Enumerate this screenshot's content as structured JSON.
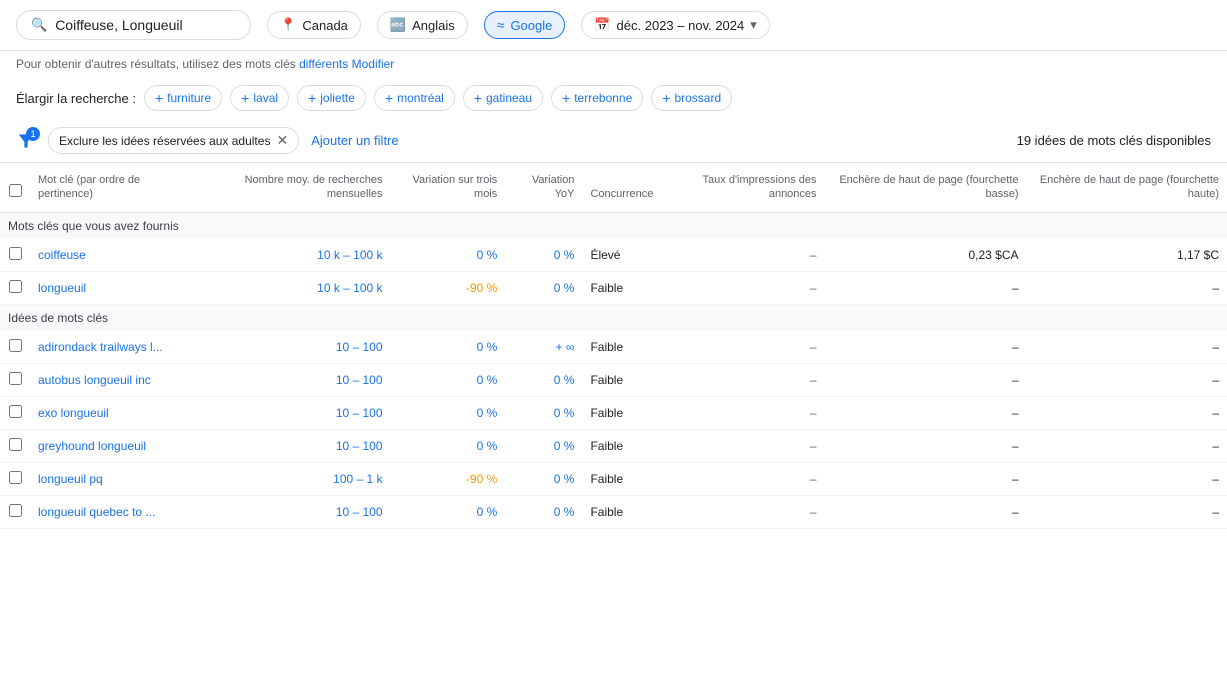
{
  "topbar": {
    "search_value": "Coiffeuse, Longueuil",
    "search_icon": "🔍",
    "location": "Canada",
    "location_icon": "📍",
    "language": "Anglais",
    "language_icon": "🔤",
    "platform": "Google",
    "platform_icon": "≈",
    "date_range": "déc. 2023 – nov. 2024",
    "date_icon": "📅"
  },
  "subtitle": {
    "text": "Pour obtenir d'autres résultats, utilisez des mots clés ",
    "link_text": "différents",
    "modify_text": "Modifier"
  },
  "expand": {
    "label": "Élargir la recherche :",
    "chips": [
      "furniture",
      "laval",
      "joliette",
      "montréal",
      "gatineau",
      "terrebonne",
      "brossard"
    ]
  },
  "toolbar": {
    "filter_badge": "1",
    "exclude_label": "Exclure les idées réservées aux adultes",
    "add_filter_label": "Ajouter un filtre",
    "ideas_count": "19 idées de mots clés disponibles"
  },
  "table": {
    "columns": [
      "",
      "Mot clé (par ordre de pertinence)",
      "Nombre moy. de recherches mensuelles",
      "Variation sur trois mois",
      "Variation YoY",
      "Concurrence",
      "Taux d'impressions des annonces",
      "Enchère de haut de page (fourchette basse)",
      "Enchère de haut de page (fourchette haute)"
    ],
    "section_provided": "Mots clés que vous avez fournis",
    "section_ideas": "Idées de mots clés",
    "rows_provided": [
      {
        "keyword": "coiffeuse",
        "monthly": "10 k – 100 k",
        "three_month": "0 %",
        "yoy": "0 %",
        "competition": "Élevé",
        "impression_rate": "–",
        "bid_low": "0,23 $CA",
        "bid_high": "1,17 $C"
      },
      {
        "keyword": "longueuil",
        "monthly": "10 k – 100 k",
        "three_month": "-90 %",
        "yoy": "0 %",
        "competition": "Faible",
        "impression_rate": "–",
        "bid_low": "–",
        "bid_high": "–"
      }
    ],
    "rows_ideas": [
      {
        "keyword": "adirondack trailways l...",
        "monthly": "10 – 100",
        "three_month": "0 %",
        "yoy": "+ ∞",
        "competition": "Faible",
        "impression_rate": "–",
        "bid_low": "–",
        "bid_high": "–"
      },
      {
        "keyword": "autobus longueuil inc",
        "monthly": "10 – 100",
        "three_month": "0 %",
        "yoy": "0 %",
        "competition": "Faible",
        "impression_rate": "–",
        "bid_low": "–",
        "bid_high": "–"
      },
      {
        "keyword": "exo longueuil",
        "monthly": "10 – 100",
        "three_month": "0 %",
        "yoy": "0 %",
        "competition": "Faible",
        "impression_rate": "–",
        "bid_low": "–",
        "bid_high": "–"
      },
      {
        "keyword": "greyhound longueuil",
        "monthly": "10 – 100",
        "three_month": "0 %",
        "yoy": "0 %",
        "competition": "Faible",
        "impression_rate": "–",
        "bid_low": "–",
        "bid_high": "–"
      },
      {
        "keyword": "longueuil pq",
        "monthly": "100 – 1 k",
        "three_month": "-90 %",
        "yoy": "0 %",
        "competition": "Faible",
        "impression_rate": "–",
        "bid_low": "–",
        "bid_high": "–"
      },
      {
        "keyword": "longueuil quebec to ...",
        "monthly": "10 – 100",
        "three_month": "0 %",
        "yoy": "0 %",
        "competition": "Faible",
        "impression_rate": "–",
        "bid_low": "–",
        "bid_high": "–"
      }
    ]
  }
}
